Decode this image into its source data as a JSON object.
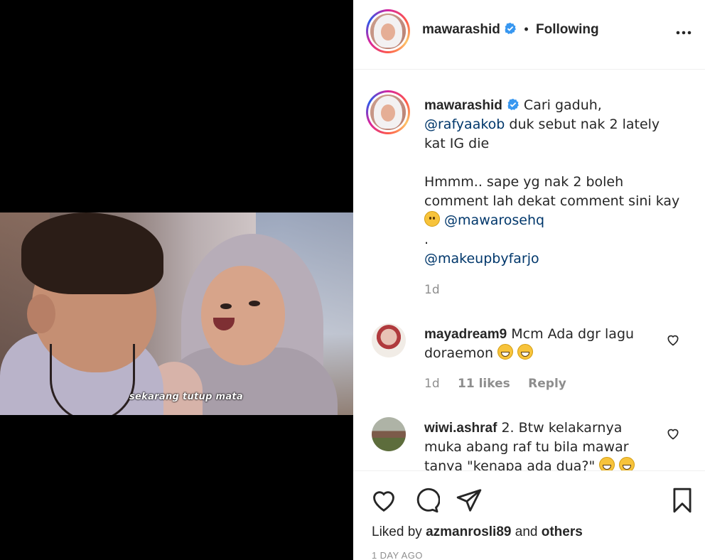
{
  "video": {
    "subtitle": "sekarang tutup mata"
  },
  "header": {
    "username": "mawarashid",
    "separator": "•",
    "follow_status": "Following"
  },
  "caption": {
    "username": "mawarashid",
    "line1": "Cari gaduh,",
    "mention1": "@rafyaakob",
    "line2": " duk sebut nak 2 lately kat IG die",
    "line3": "Hmmm.. sape yg nak 2 boleh comment lah dekat comment sini kay",
    "mention2": "@mawarosehq",
    "dot": ".",
    "mention3": "@makeupbyfarjo",
    "time": "1d"
  },
  "comments": [
    {
      "username": "mayadream9",
      "text": "Mcm Ada dgr lagu doraemon",
      "time": "1d",
      "likes": "11 likes",
      "reply": "Reply"
    },
    {
      "username": "wiwi.ashraf",
      "text": "2. Btw kelakarnya muka abang raf tu bila mawar tanya \"kenapa ada dua?\""
    }
  ],
  "footer": {
    "liked_prefix": "Liked by",
    "liked_user": "azmanrosli89",
    "liked_and": "and",
    "liked_others": "others",
    "posted_ago": "1 DAY AGO"
  },
  "colors": {
    "verified": "#3897f0",
    "mention": "#00376b",
    "muted": "#8e8e8e"
  }
}
